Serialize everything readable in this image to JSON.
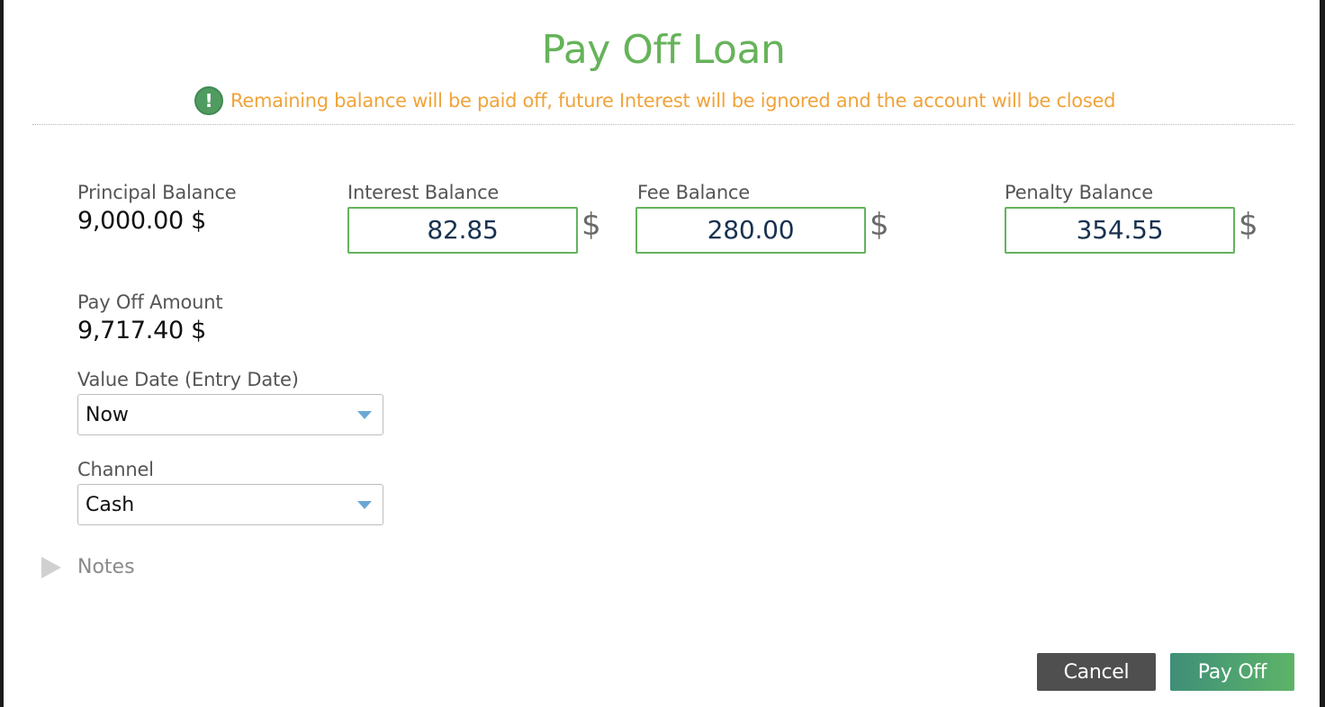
{
  "dialog": {
    "title": "Pay Off Loan",
    "warning": "Remaining balance will be paid off, future Interest will be ignored and the account will be closed",
    "warning_icon": "!"
  },
  "balances": {
    "principal": {
      "label": "Principal Balance",
      "value": "9,000.00 $"
    },
    "interest": {
      "label": "Interest Balance",
      "value": "82.85",
      "currency": "$"
    },
    "fee": {
      "label": "Fee Balance",
      "value": "280.00",
      "currency": "$"
    },
    "penalty": {
      "label": "Penalty Balance",
      "value": "354.55",
      "currency": "$"
    }
  },
  "payoff": {
    "label": "Pay Off Amount",
    "value": "9,717.40 $"
  },
  "value_date": {
    "label": "Value Date (Entry Date)",
    "selected": "Now"
  },
  "channel": {
    "label": "Channel",
    "selected": "Cash"
  },
  "notes": {
    "label": "Notes"
  },
  "buttons": {
    "cancel": "Cancel",
    "pay_off": "Pay Off"
  },
  "colors": {
    "title": "#66b35a",
    "warning": "#f0a33a",
    "input_border": "#63b35c",
    "cancel_bg": "#4f4f4f"
  }
}
